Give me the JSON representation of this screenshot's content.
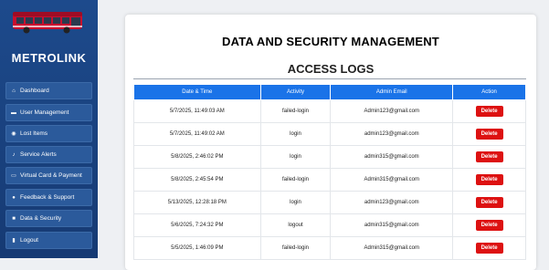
{
  "sidebar": {
    "brand": "METROLINK",
    "items": [
      {
        "label": "Dashboard",
        "icon": "home-icon",
        "glyph": "⌂"
      },
      {
        "label": "User Management",
        "icon": "folder-icon",
        "glyph": "▬"
      },
      {
        "label": "Lost Items",
        "icon": "search-icon",
        "glyph": "◉"
      },
      {
        "label": "Service Alerts",
        "icon": "bell-icon",
        "glyph": "♪"
      },
      {
        "label": "Virtual Card & Payment",
        "icon": "card-icon",
        "glyph": "▭"
      },
      {
        "label": "Feedback & Support",
        "icon": "chat-icon",
        "glyph": "●"
      },
      {
        "label": "Data & Security",
        "icon": "lock-icon",
        "glyph": "■"
      },
      {
        "label": "Logout",
        "icon": "logout-icon",
        "glyph": "▮"
      }
    ]
  },
  "main": {
    "title": "DATA AND SECURITY MANAGEMENT",
    "subtitle": "ACCESS LOGS",
    "columns": [
      "Date & Time",
      "Activity",
      "Admin Email",
      "Action"
    ],
    "action_label": "Delete",
    "rows": [
      {
        "datetime": "5/7/2025, 11:49:03 AM",
        "activity": "failed-login",
        "email": "Admin123@gmail.com"
      },
      {
        "datetime": "5/7/2025, 11:49:02 AM",
        "activity": "login",
        "email": "admin123@gmail.com"
      },
      {
        "datetime": "5/8/2025, 2:46:02 PM",
        "activity": "login",
        "email": "admin315@gmail.com"
      },
      {
        "datetime": "5/8/2025, 2:45:54 PM",
        "activity": "failed-login",
        "email": "Admin315@gmail.com"
      },
      {
        "datetime": "5/13/2025, 12:28:18 PM",
        "activity": "login",
        "email": "admin123@gmail.com"
      },
      {
        "datetime": "5/6/2025, 7:24:32 PM",
        "activity": "logout",
        "email": "admin315@gmail.com"
      },
      {
        "datetime": "5/5/2025, 1:46:09 PM",
        "activity": "failed-login",
        "email": "Admin315@gmail.com"
      }
    ]
  },
  "colors": {
    "sidebar": "#1d4a8c",
    "header_blue": "#1a73e8",
    "delete_red": "#dd1111"
  }
}
